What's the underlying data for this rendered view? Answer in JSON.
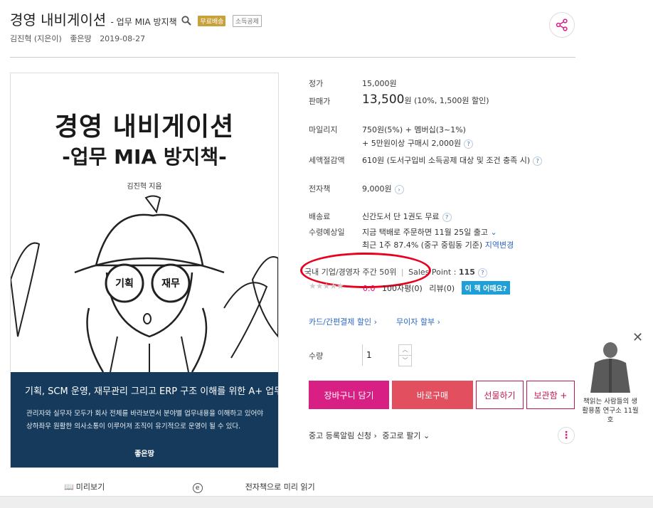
{
  "header": {
    "title": "경영 내비게이션",
    "subtitle": "- 업무 MIA 방지책",
    "badge_free": "무료배송",
    "badge_deduct": "소득공제",
    "author": "김진혁 (지은이)",
    "publisher": "좋은땅",
    "date": "2019-08-27"
  },
  "cover": {
    "title_line1": "경영 내비게이션",
    "title_line2": "-업무 MIA 방지책-",
    "author": "김진혁 지음",
    "left_lens": "기획",
    "right_lens": "재무",
    "band_headline": "기획, SCM 운영, 재무관리 그리고 ERP 구조 이해를 위한 A+ 업무노트",
    "band_text": "관리자와 실무자 모두가 회사 전체를 바라보면서 분야별 업무내용을 이해하고 있어야 상하좌우 원활한 의사소통이 이루어져 조직이 유기적으로 운영이 될 수 있다.",
    "band_publisher": "좋은땅"
  },
  "preview": {
    "preview_label": "미리보기",
    "ebook_label": "전자책으로 미리 읽기"
  },
  "info": {
    "list_price_label": "정가",
    "list_price": "15,000원",
    "sale_price_label": "판매가",
    "sale_price": "13,500",
    "sale_price_unit": "원",
    "sale_detail": "(10%, 1,500원 할인)",
    "mileage_label": "마일리지",
    "mileage_line1": "750원(5%) + 멤버십(3~1%)",
    "mileage_line2": "+ 5만원이상 구매시 2,000원",
    "tax_label": "세액절감액",
    "tax_value": "610원 (도서구입비 소득공제 대상 및 조건 충족 시)",
    "ebook_label": "전자책",
    "ebook_price": "9,000원",
    "ship_label": "배송료",
    "ship_value": "신간도서 단 1권도 무료",
    "expected_label": "수령예상일",
    "expected_line1": "지금 택배로 주문하면 11월 25일 출고",
    "expected_line2": "최근 1주 87.4% (중구 중림동 기준)",
    "region_change": "지역변경",
    "rank_text": "국내 기업/경영자 주간 50위",
    "sales_point_label": "Sales Point :",
    "sales_point": "115",
    "rating": "0.0",
    "review_100": "100자평(0)",
    "review": "리뷰(0)",
    "how_button": "이 책 어때요?",
    "card_discount": "카드/간편결제 할인",
    "installment": "무이자 할부",
    "qty_label": "수량",
    "qty_value": "1",
    "cart_button": "장바구니 담기",
    "buy_button": "바로구매",
    "gift_button": "선물하기",
    "keep_button": "보관함 +",
    "used_alert": "중고 등록알림 신청",
    "used_sell": "중고로 팔기"
  },
  "side_ad": {
    "text": "책읽는 사람들의 생활용품 연구소 11월호"
  }
}
